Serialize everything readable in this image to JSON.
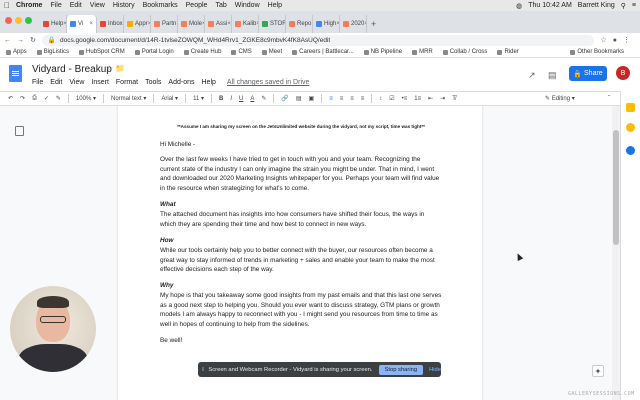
{
  "mac_menubar": {
    "apple": "",
    "items": [
      "Chrome",
      "File",
      "Edit",
      "View",
      "History",
      "Bookmarks",
      "People",
      "Tab",
      "Window",
      "Help"
    ],
    "clock": "Thu 10:42 AM",
    "user": "Barrett King"
  },
  "tabs": [
    {
      "label": "Help",
      "color": "#ea4335"
    },
    {
      "label": "Vi",
      "color": "#4285f4",
      "active": true
    },
    {
      "label": "Inbox",
      "color": "#ea4335"
    },
    {
      "label": "Appr",
      "color": "#f9ab00"
    },
    {
      "label": "Partn",
      "color": "#ff7a59"
    },
    {
      "label": "Mole",
      "color": "#ff7a59"
    },
    {
      "label": "Assi",
      "color": "#ff7a59"
    },
    {
      "label": "Kalib",
      "color": "#ff7a59"
    },
    {
      "label": "STOR",
      "color": "#34a853"
    },
    {
      "label": "Repo",
      "color": "#ff7a59"
    },
    {
      "label": "High",
      "color": "#4285f4"
    },
    {
      "label": "2020",
      "color": "#ff7a59"
    }
  ],
  "address": {
    "url": "docs.google.com/document/d/14R-1tvlseZOWQM_WHd4Rrv1_ZGKE8c9mbvK4fK8AsUQ/edit"
  },
  "bookmarks": {
    "items": [
      "Apps",
      "BigListics",
      "HubSpot CRM",
      "Portal Login",
      "Create Hub",
      "CMS",
      "Meet",
      "Careers | Battlecar...",
      "NB Pipeline",
      "MRR",
      "Collab / Cross",
      "Rider"
    ],
    "other": "Other Bookmarks"
  },
  "doc": {
    "title": "Vidyard - Breakup",
    "menus": [
      "File",
      "Edit",
      "View",
      "Insert",
      "Format",
      "Tools",
      "Add-ons",
      "Help"
    ],
    "saved": "All changes saved in Drive",
    "share": "Share",
    "avatar": "B"
  },
  "toolbar": {
    "zoom": "100%",
    "style": "Normal text",
    "font": "Arial",
    "size": "11",
    "bold": "B",
    "italic": "I",
    "underline": "U",
    "color": "A",
    "mode": "Editing"
  },
  "content": {
    "note": "**Assume I am sharing my screen on the JetsUnlimited website during the vidyard, not my script, time was tight**",
    "greeting": "Hi Michelle -",
    "para1": "Over the last few weeks I have tried to get in touch with you and your team. Recognizing the current state of the industry I can only imagine the strain you might be under. That in mind, I went and downloaded our 2020 Marketing Insights whitepaper for you. Perhaps your team will find value in the resource when strategizing for what's to come.",
    "h_what": "What",
    "para2": "The attached document has insights into how consumers have shifted their focus, the ways in which they are spending their time and how best to connect in new ways.",
    "h_how": "How",
    "para3": "While our tools certainly help you to better connect with the buyer, our resources often become a great way to stay informed of trends in marketing + sales and enable your team to make the most effective decisions each step of the way.",
    "h_why": "Why",
    "para4": "My hope is that you takeaway some good insights from my past emails and that this last one serves as a good next step to helping you. Should you ever want to discuss strategy, GTM plans or growth models I am always happy to reconnect with you - I might send you resources from time to time as well in hopes of continuing to help from the sidelines.",
    "signoff": "Be well!"
  },
  "notification": {
    "text": "Screen and Webcam Recorder - Vidyard is sharing your screen.",
    "stop": "Stop sharing",
    "hide": "Hide"
  },
  "watermark": "GALLERYSESSIONS.COM"
}
